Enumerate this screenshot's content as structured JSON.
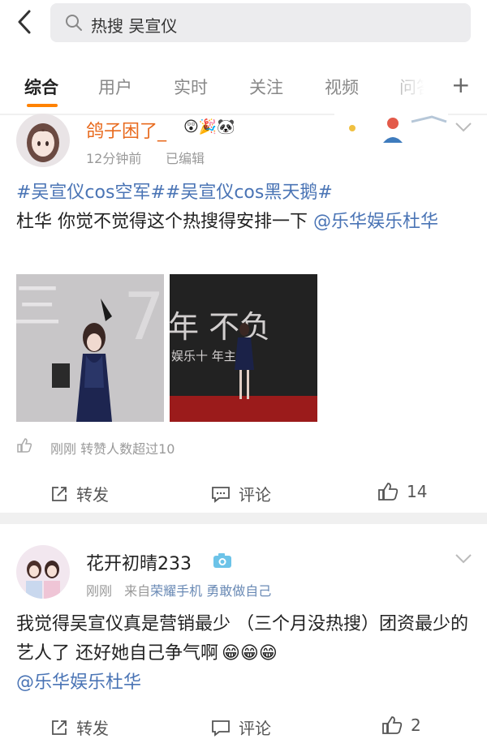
{
  "search": {
    "query": "热搜 吴宣仪"
  },
  "tabs": [
    {
      "label": "综合"
    },
    {
      "label": "用户"
    },
    {
      "label": "实时"
    },
    {
      "label": "关注"
    },
    {
      "label": "视频"
    },
    {
      "label": "问答"
    }
  ],
  "posts": [
    {
      "username": "鸽子困了_",
      "time": "12分钟前",
      "edited": "已编辑",
      "hashtags": "#吴宣仪cos空军##吴宣仪cos黑天鹅#",
      "text": "杜华 你觉不觉得这个热搜得安排一下",
      "mention": "@乐华娱乐杜华",
      "poster_text": "年 不负",
      "poster_sub": "娱乐十 年主题",
      "footer": "刚刚 转赞人数超过10",
      "repost_label": "转发",
      "comment_label": "评论",
      "like_count": "14"
    },
    {
      "username": "花开初晴233",
      "time": "刚刚",
      "source_prefix": "来自",
      "source": "荣耀手机 勇敢做自己",
      "text": "我觉得吴宣仪真是营销最少 （三个月没热搜）团资最少的艺人了 还好她自己争气啊",
      "emoji": "😁😁😁",
      "mention": "@乐华娱乐杜华",
      "repost_label": "转发",
      "comment_label": "评论",
      "like_count": "2"
    }
  ],
  "colors": {
    "accent": "#ff8200",
    "link": "#4a74b5",
    "username": "#e86b1f"
  }
}
